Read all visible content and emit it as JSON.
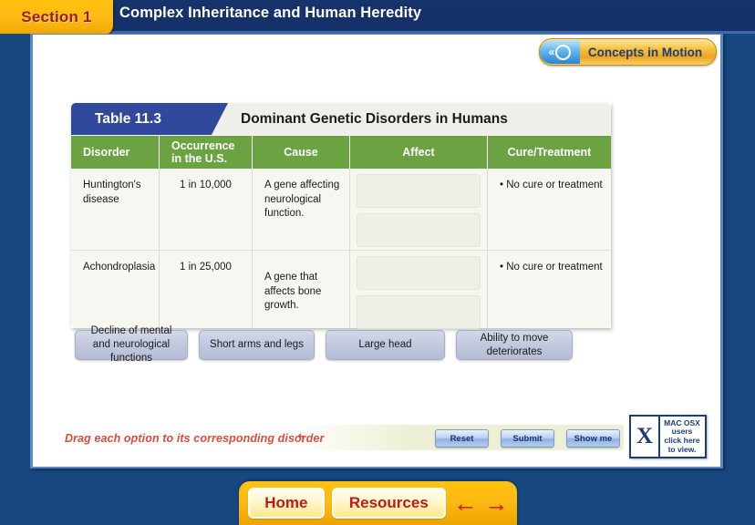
{
  "header": {
    "section_label": "Section 1",
    "title": "Complex Inheritance and Human Heredity"
  },
  "concepts_in_motion": {
    "label": "Concepts in Motion",
    "icon": "motion-waves-icon"
  },
  "table": {
    "tag": "Table 11.3",
    "title": "Dominant Genetic Disorders in Humans",
    "columns": [
      "Disorder",
      "Occurrence in the U.S.",
      "Cause",
      "Affect",
      "Cure/Treatment"
    ],
    "column_lines": {
      "occurrence_line1": "Occurrence",
      "occurrence_line2": "in the U.S."
    },
    "rows": [
      {
        "disorder": "Huntington's disease",
        "occurrence": "1 in 10,000",
        "cause": "A gene affecting neurological function.",
        "affect_dropzones": 2,
        "cure": "• No cure or treatment"
      },
      {
        "disorder": "Achondroplasia",
        "occurrence": "1 in 25,000",
        "cause": "A gene that affects bone growth.",
        "affect_dropzones": 2,
        "cure": "• No cure or treatment"
      }
    ]
  },
  "options": [
    {
      "label": "Decline of mental and neurological functions"
    },
    {
      "label": "Short arms and legs"
    },
    {
      "label": "Large head"
    },
    {
      "label": "Ability to move deteriorates"
    }
  ],
  "instruction": {
    "text": "Drag each option to its corresponding disorder",
    "arrow_glyph": "↰"
  },
  "actions": [
    {
      "label": "Reset"
    },
    {
      "label": "Submit"
    },
    {
      "label": "Show me"
    }
  ],
  "mac_notice": {
    "x_glyph": "X",
    "line1": "MAC OSX",
    "line2": "users",
    "line3": "click here",
    "line4": "to view."
  },
  "nav": {
    "home": "Home",
    "resources": "Resources",
    "back_arrow": "←",
    "forward_arrow": "→"
  },
  "colors": {
    "frame_navy": "#17336b",
    "frame_blue": "#16477f",
    "accent_yellow": "#fdb913",
    "table_green": "#6ba343",
    "table_tag_blue": "#31499c",
    "instruction_red": "#e04a3c"
  }
}
